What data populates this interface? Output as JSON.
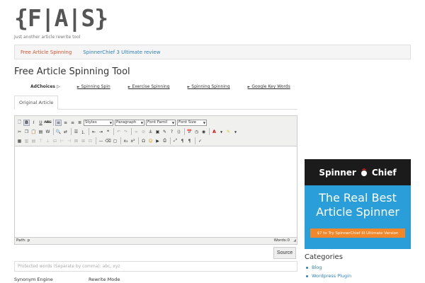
{
  "site": {
    "logo": "{F|A|S}",
    "tagline": "Just another article rewrite tool"
  },
  "nav": {
    "items": [
      {
        "label": "Free Article Spinning",
        "active": true
      },
      {
        "label": "SpinnerChief 3 Ultimate review",
        "active": false
      }
    ]
  },
  "page": {
    "title": "Free Article Spinning Tool"
  },
  "ads": {
    "adchoices": "AdChoices",
    "links": [
      "Spinning Spin",
      "Exercise Spinning",
      "Spinning Spinning",
      "Google Key Words"
    ]
  },
  "tabs": {
    "original": "Original Article"
  },
  "editor": {
    "selects": {
      "styles": "Styles",
      "paragraph": "Paragraph",
      "font_family": "Font Famil",
      "font_size": "Font Size"
    },
    "path_label": "Path: p",
    "words_label": "Words:0"
  },
  "actions": {
    "source": "Source"
  },
  "protected": {
    "placeholder": "Protected words (Separate by comma): abc, xyz"
  },
  "options": {
    "synonym_engine": "Synonym Engine",
    "rewrite_mode": "Rewrite Mode"
  },
  "banner": {
    "brand_left": "Spinner",
    "brand_right": "Chief",
    "headline1": "The Real Best",
    "headline2": "Article Spinner",
    "cta": "$7 to Try SpinnerChief III Ultimate Version"
  },
  "sidebar": {
    "categories_title": "Categories",
    "categories": [
      "Blog",
      "Wordpress Plugin"
    ]
  },
  "colors": {
    "nav_active": "#d9502e",
    "link": "#2f7fb8",
    "banner_bg": "#2a9ed8",
    "banner_cta": "#f0872a"
  }
}
